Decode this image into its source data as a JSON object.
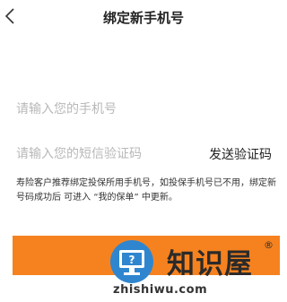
{
  "header": {
    "title": "绑定新手机号",
    "back_icon": "chevron-left-icon"
  },
  "form": {
    "phone_placeholder": "请输入您的手机号",
    "phone_value": "",
    "code_placeholder": "请输入您的短信验证码",
    "code_value": "",
    "send_code_label": "发送验证码",
    "notice": "寿险客户推荐绑定投保所用手机号，如投保手机号已不用，绑定新号码成功后 可进入 “我的保单” 中更新。",
    "submit_label": ""
  },
  "watermark": {
    "brand": "知识屋",
    "registered_mark": "®",
    "domain": "zhishiwu.com",
    "logo_icon": "monitor-question-icon"
  },
  "colors": {
    "accent": "#f5821f",
    "placeholder": "#b8b8b8",
    "logo_blue": "#2f86cf"
  }
}
